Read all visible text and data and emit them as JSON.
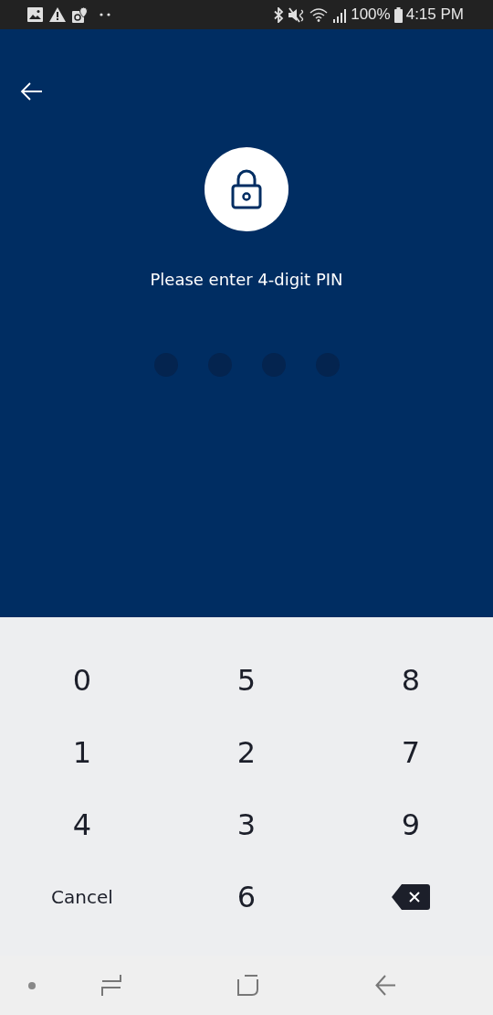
{
  "status_bar": {
    "battery": "100%",
    "time": "4:15 PM"
  },
  "prompt": "Please enter 4-digit PIN",
  "pin_dots": [
    {
      "filled": false
    },
    {
      "filled": false
    },
    {
      "filled": false
    },
    {
      "filled": false
    }
  ],
  "keypad": [
    {
      "kind": "digit",
      "label": "0"
    },
    {
      "kind": "digit",
      "label": "5"
    },
    {
      "kind": "digit",
      "label": "8"
    },
    {
      "kind": "digit",
      "label": "1"
    },
    {
      "kind": "digit",
      "label": "2"
    },
    {
      "kind": "digit",
      "label": "7"
    },
    {
      "kind": "digit",
      "label": "4"
    },
    {
      "kind": "digit",
      "label": "3"
    },
    {
      "kind": "digit",
      "label": "9"
    },
    {
      "kind": "text",
      "label": "Cancel"
    },
    {
      "kind": "digit",
      "label": "6"
    },
    {
      "kind": "delete"
    }
  ]
}
